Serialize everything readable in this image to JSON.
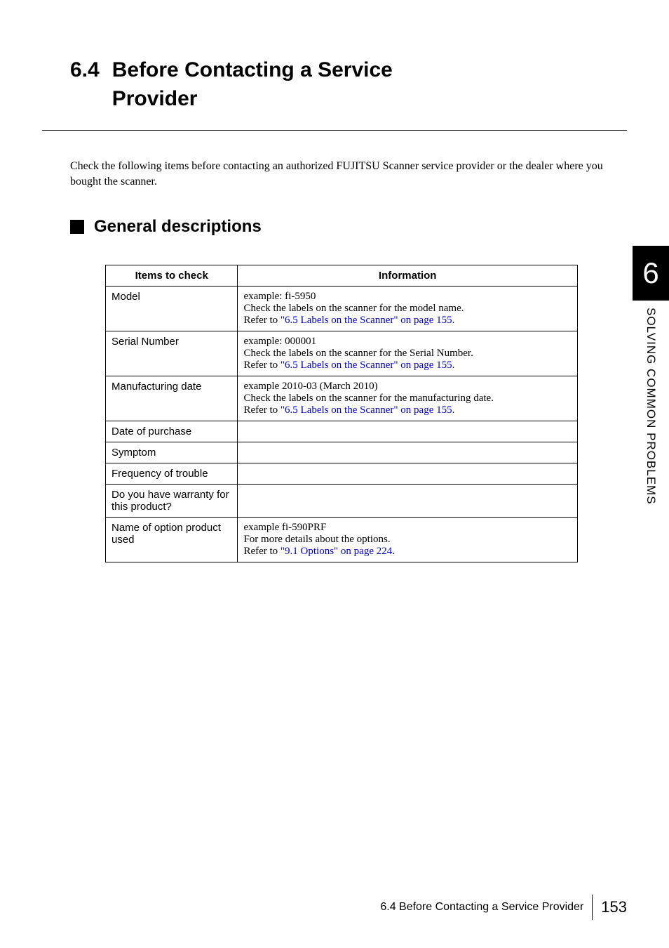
{
  "section": {
    "number": "6.4",
    "title_line1": "Before Contacting a Service",
    "title_line2": "Provider"
  },
  "intro": "Check the following items before contacting an authorized FUJITSU Scanner service provider or the dealer where you bought the scanner.",
  "sub_heading": "General descriptions",
  "side_tab": {
    "number": "6",
    "text": "SOLVING COMMON PROBLEMS"
  },
  "table": {
    "header": {
      "col1": "Items to check",
      "col2": "Information"
    },
    "rows": [
      {
        "label": "Model",
        "info_line1": "example: fi-5950",
        "info_line2": "Check the labels on the scanner for the model name.",
        "info_prefix": "Refer to ",
        "info_link": "\"6.5 Labels on the Scanner\" on page 155",
        "info_suffix": "."
      },
      {
        "label": "Serial Number",
        "info_line1": "example: 000001",
        "info_line2": "Check the labels on the scanner for the Serial Number.",
        "info_prefix": "Refer to ",
        "info_link": "\"6.5 Labels on the Scanner\" on page 155",
        "info_suffix": "."
      },
      {
        "label": "Manufacturing date",
        "info_line1": "example 2010-03 (March 2010)",
        "info_line2": "Check the labels on the scanner for the manufacturing date.",
        "info_prefix": "Refer to ",
        "info_link": "\"6.5 Labels on the Scanner\" on page 155",
        "info_suffix": "."
      },
      {
        "label": "Date of purchase",
        "empty": true
      },
      {
        "label": "Symptom",
        "empty": true
      },
      {
        "label": "Frequency of trouble",
        "empty": true
      },
      {
        "label": "Do you have warranty for this product?",
        "empty": true
      },
      {
        "label": "Name of option product used",
        "info_line1": "example fi-590PRF",
        "info_line2": "For more details about the options.",
        "info_prefix": "Refer to ",
        "info_link": "\"9.1 Options\" on page 224",
        "info_suffix": "."
      }
    ]
  },
  "footer": {
    "text": "6.4 Before Contacting a Service Provider",
    "page": "153"
  }
}
